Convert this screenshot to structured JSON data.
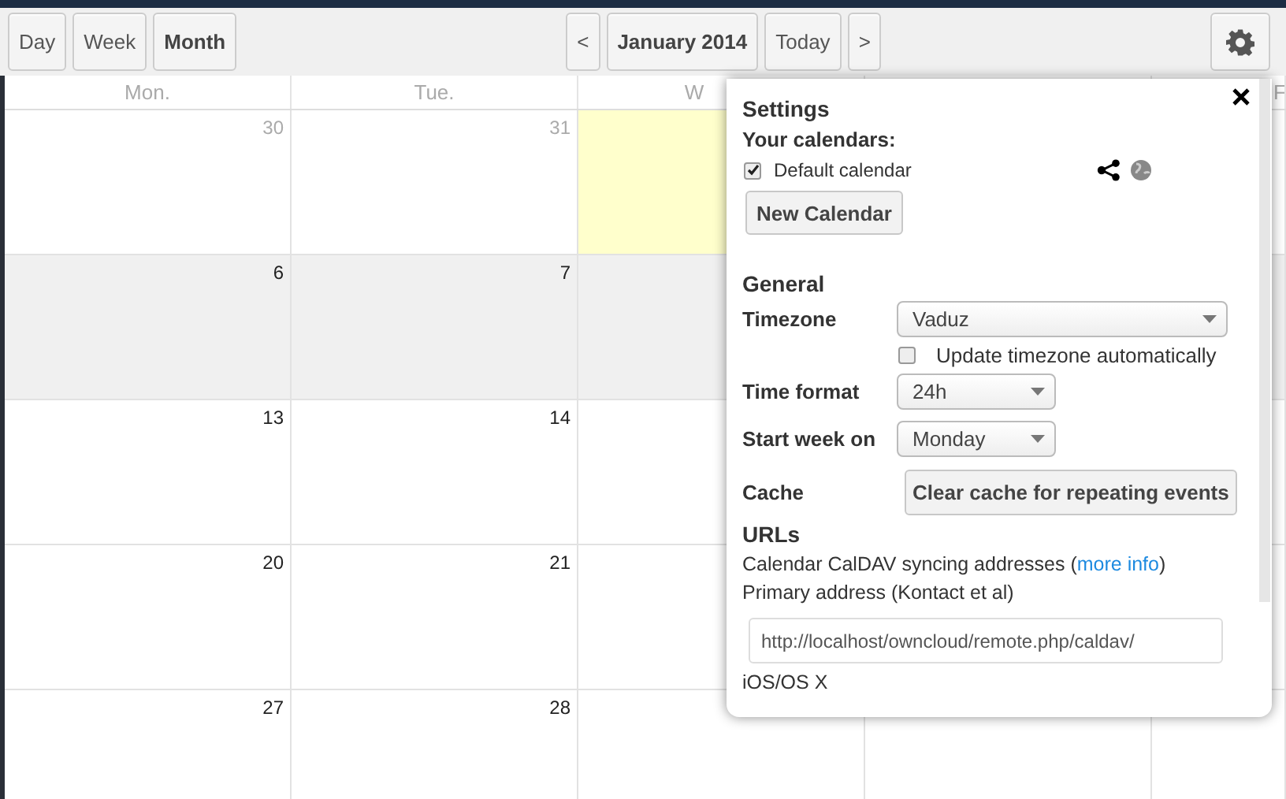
{
  "toolbar": {
    "views": [
      {
        "label": "Day",
        "selected": false
      },
      {
        "label": "Week",
        "selected": false
      },
      {
        "label": "Month",
        "selected": true
      }
    ],
    "prev": "<",
    "period": "January 2014",
    "today": "Today",
    "next": ">"
  },
  "calendar": {
    "headers": [
      "Mon.",
      "Tue.",
      "W"
    ],
    "edge_header": "F",
    "weeks": [
      {
        "highlighted": false,
        "cells": [
          {
            "day": "30",
            "muted": true,
            "today": false
          },
          {
            "day": "31",
            "muted": true,
            "today": false
          },
          {
            "today": true
          }
        ]
      },
      {
        "highlighted": true,
        "cells": [
          {
            "day": "6",
            "muted": false,
            "today": false
          },
          {
            "day": "7",
            "muted": false,
            "today": false
          },
          {
            "today": false
          }
        ]
      },
      {
        "highlighted": false,
        "cells": [
          {
            "day": "13",
            "muted": false,
            "today": false
          },
          {
            "day": "14",
            "muted": false,
            "today": false
          },
          {
            "today": false
          }
        ]
      },
      {
        "highlighted": false,
        "cells": [
          {
            "day": "20",
            "muted": false,
            "today": false
          },
          {
            "day": "21",
            "muted": false,
            "today": false
          },
          {
            "today": false
          }
        ]
      },
      {
        "highlighted": false,
        "cells": [
          {
            "day": "27",
            "muted": false,
            "today": false
          },
          {
            "day": "28",
            "muted": false,
            "today": false
          },
          {
            "today": false
          }
        ]
      }
    ]
  },
  "settings": {
    "title": "Settings",
    "calendars_heading": "Your calendars:",
    "calendars": [
      {
        "name": "Default calendar",
        "checked": true
      }
    ],
    "new_calendar": "New Calendar",
    "general_heading": "General",
    "timezone": {
      "label": "Timezone",
      "value": "Vaduz"
    },
    "auto_timezone": {
      "label": "Update timezone automatically",
      "checked": false
    },
    "time_format": {
      "label": "Time format",
      "value": "24h"
    },
    "start_week": {
      "label": "Start week on",
      "value": "Monday"
    },
    "cache": {
      "label": "Cache",
      "button": "Clear cache for repeating events"
    },
    "urls_heading": "URLs",
    "caldav_note": {
      "before": "Calendar CalDAV syncing addresses (",
      "link": "more info",
      "after": ")"
    },
    "primary_label": "Primary address (Kontact et al)",
    "primary_url": "http://localhost/owncloud/remote.php/caldav/",
    "ios_label": "iOS/OS X"
  }
}
